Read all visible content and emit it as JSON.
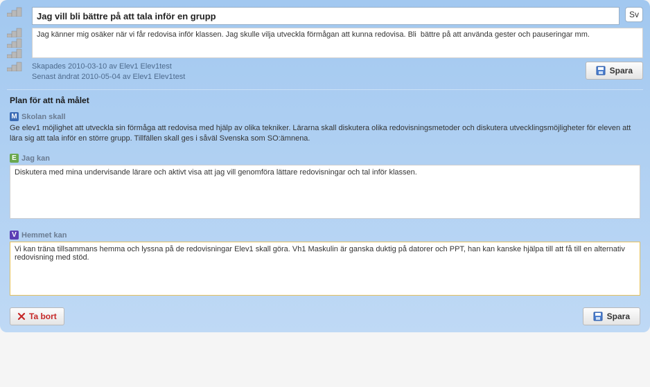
{
  "header": {
    "title": "Jag vill bli bättre på att tala inför en grupp",
    "lang": "Sv",
    "description": "Jag känner mig osäker när vi får redovisa inför klassen. Jag skulle vilja utveckla förmågan att kunna redovisa. Bli  bättre på att använda gester och pauseringar mm.",
    "created": "Skapades 2010-03-10 av Elev1 Elev1test",
    "modified": "Senast ändrat 2010-05-04 av Elev1 Elev1test",
    "save_label": "Spara"
  },
  "plan": {
    "heading": "Plan för att nå målet",
    "skolan": {
      "badge": "M",
      "label": "Skolan skall",
      "text": "Ge elev1 möjlighet att utveckla sin förmåga att redovisa med hjälp av olika tekniker. Lärarna skall diskutera olika redovisningsmetoder och diskutera utvecklingsmöjligheter för eleven att lära sig att tala inför en större grupp. Tillfällen skall ges i såväl Svenska som SO:ämnena."
    },
    "jag": {
      "badge": "E",
      "label": "Jag kan",
      "text": "Diskutera med mina undervisande lärare och aktivt visa att jag vill genomföra lättare redovisningar och tal inför klassen."
    },
    "hemmet": {
      "badge": "V",
      "label": "Hemmet kan",
      "text": "Vi kan träna tillsammans hemma och lyssna på de redovisningar Elev1 skall göra. Vh1 Maskulin är ganska duktig på datorer och PPT, han kan kanske hjälpa till att få till en alternativ redovisning med stöd."
    }
  },
  "footer": {
    "delete_label": "Ta bort",
    "save_label": "Spara"
  }
}
